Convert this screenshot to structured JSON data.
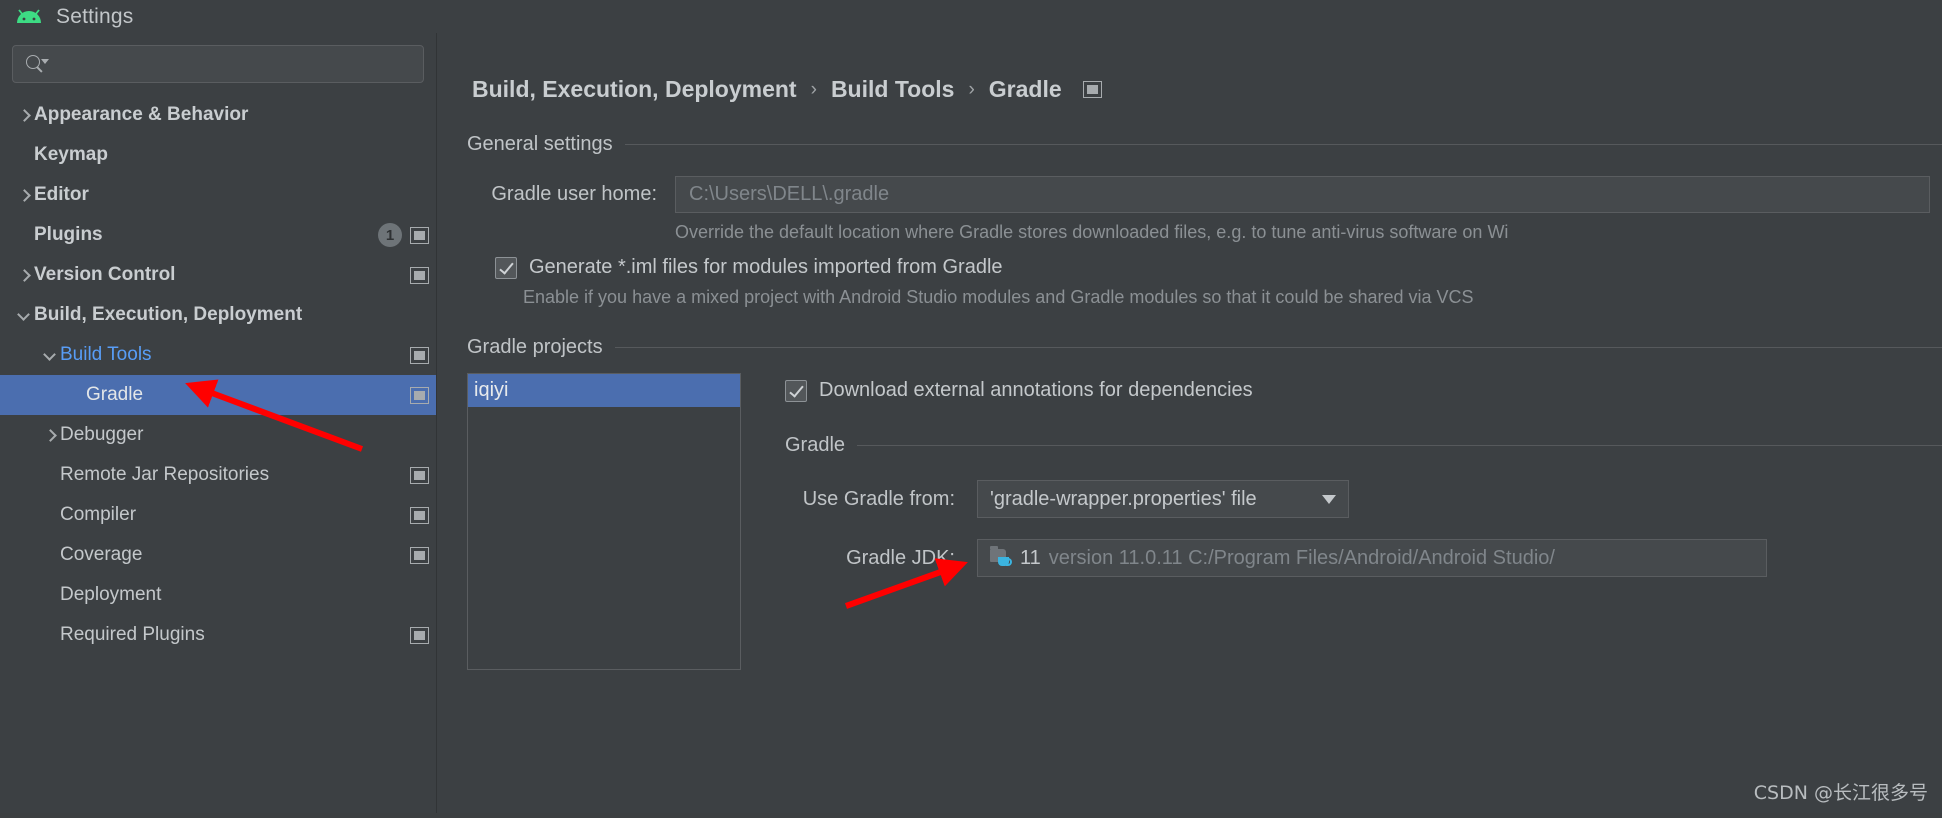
{
  "window": {
    "title": "Settings",
    "logo_icon": "android-logo-icon"
  },
  "search": {
    "value": "",
    "placeholder": "",
    "icon": "search-icon"
  },
  "sidebar": {
    "items": [
      {
        "label": "Appearance & Behavior",
        "indent": 0,
        "twisty": "right",
        "bold": true,
        "badge": "",
        "trailing_icon": ""
      },
      {
        "label": "Keymap",
        "indent": 0,
        "twisty": "none",
        "bold": true,
        "badge": "",
        "trailing_icon": ""
      },
      {
        "label": "Editor",
        "indent": 0,
        "twisty": "right",
        "bold": true,
        "badge": "",
        "trailing_icon": ""
      },
      {
        "label": "Plugins",
        "indent": 0,
        "twisty": "none",
        "bold": true,
        "badge": "1",
        "trailing_icon": "window-icon"
      },
      {
        "label": "Version Control",
        "indent": 0,
        "twisty": "right",
        "bold": true,
        "badge": "",
        "trailing_icon": "window-icon"
      },
      {
        "label": "Build, Execution, Deployment",
        "indent": 0,
        "twisty": "down",
        "bold": true,
        "badge": "",
        "trailing_icon": ""
      },
      {
        "label": "Build Tools",
        "indent": 1,
        "twisty": "down",
        "bold": false,
        "link": true,
        "badge": "",
        "trailing_icon": "window-icon"
      },
      {
        "label": "Gradle",
        "indent": 2,
        "twisty": "none",
        "bold": false,
        "selected": true,
        "badge": "",
        "trailing_icon": "window-icon"
      },
      {
        "label": "Debugger",
        "indent": 1,
        "twisty": "right",
        "bold": false,
        "badge": "",
        "trailing_icon": ""
      },
      {
        "label": "Remote Jar Repositories",
        "indent": 1,
        "twisty": "none",
        "bold": false,
        "badge": "",
        "trailing_icon": "window-icon"
      },
      {
        "label": "Compiler",
        "indent": 1,
        "twisty": "none",
        "bold": false,
        "badge": "",
        "trailing_icon": "window-icon"
      },
      {
        "label": "Coverage",
        "indent": 1,
        "twisty": "none",
        "bold": false,
        "badge": "",
        "trailing_icon": "window-icon"
      },
      {
        "label": "Deployment",
        "indent": 1,
        "twisty": "none",
        "bold": false,
        "badge": "",
        "trailing_icon": ""
      },
      {
        "label": "Required Plugins",
        "indent": 1,
        "twisty": "none",
        "bold": false,
        "badge": "",
        "trailing_icon": "window-icon"
      }
    ]
  },
  "breadcrumb": {
    "items": [
      "Build, Execution, Deployment",
      "Build Tools",
      "Gradle"
    ],
    "separator": "›",
    "trailing_icon": "window-icon"
  },
  "general_settings": {
    "title": "General settings",
    "gradle_user_home": {
      "label": "Gradle user home:",
      "value": "C:\\Users\\DELL\\.gradle"
    },
    "gradle_user_home_hint": "Override the default location where Gradle stores downloaded files, e.g. to tune anti-virus software on Wi",
    "generate_iml": {
      "label": "Generate *.iml files for modules imported from Gradle",
      "checked": true
    },
    "generate_iml_hint": "Enable if you have a mixed project with Android Studio modules and Gradle modules so that it could be shared via VCS"
  },
  "gradle_projects": {
    "title": "Gradle projects",
    "list": [
      {
        "label": "iqiyi",
        "selected": true
      }
    ],
    "download_annotations": {
      "label": "Download external annotations for dependencies",
      "checked": true
    },
    "gradle_group_title": "Gradle",
    "use_gradle_from": {
      "label": "Use Gradle from:",
      "value": "'gradle-wrapper.properties' file",
      "caret_icon": "chevron-down-icon"
    },
    "gradle_jdk": {
      "label": "Gradle JDK:",
      "icon": "jdk-folder-icon",
      "version_short": "11",
      "path": "version 11.0.11 C:/Program Files/Android/Android Studio/"
    }
  },
  "watermark": "CSDN @长江很多号",
  "colors": {
    "background": "#3c4043",
    "selection": "#4b6eaf",
    "link": "#589df6",
    "accent_green": "#3ddc84",
    "annotation_red": "#ff0000"
  }
}
